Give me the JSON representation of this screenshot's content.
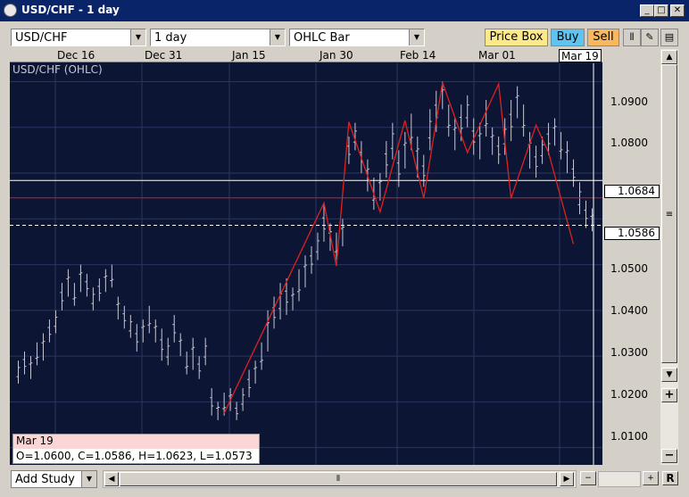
{
  "window": {
    "title": "USD/CHF - 1 day"
  },
  "toolbar": {
    "symbol": "USD/CHF",
    "period": "1 day",
    "chart_type": "OHLC Bar",
    "price_box_label": "Price Box",
    "buy_label": "Buy",
    "sell_label": "Sell"
  },
  "chart": {
    "label": "USD/CHF (OHLC)",
    "dates": [
      "Dec 16",
      "Dec 31",
      "Jan 15",
      "Jan 30",
      "Feb 14",
      "Mar 01",
      "Mar 19"
    ],
    "price_labels": [
      "1.0900",
      "1.0800",
      "1.0500",
      "1.0400",
      "1.0300",
      "1.0200",
      "1.0100"
    ],
    "line_price_white": "1.0684",
    "line_price_last": "1.0586",
    "colors": {
      "background": "#0d1535",
      "bars": "#c8c8d2",
      "zigzag": "#e02020",
      "hline_red": "#cc2222"
    }
  },
  "info": {
    "date": "Mar 19",
    "ohlc": "O=1.0600, C=1.0586, H=1.0623, L=1.0573"
  },
  "bottom": {
    "add_study": "Add Study",
    "r_label": "R"
  },
  "chart_data": {
    "type": "ohlc",
    "x_tick_labels": [
      "Dec 16",
      "Dec 31",
      "Jan 15",
      "Jan 30",
      "Feb 14",
      "Mar 01",
      "Mar 19"
    ],
    "y_tick_labels": [
      "1.0900",
      "1.0800",
      "1.0500",
      "1.0400",
      "1.0300",
      "1.0200",
      "1.0100"
    ],
    "ylim": [
      1.007,
      1.094
    ],
    "last_bar": {
      "date": "Mar 19",
      "open": 1.06,
      "high": 1.0623,
      "low": 1.0573,
      "close": 1.0586
    },
    "hlines": [
      {
        "value": 1.0684,
        "color": "white"
      },
      {
        "value": 1.0646,
        "color": "red"
      },
      {
        "value": 1.0586,
        "color": "white-dashed"
      }
    ],
    "bars_hl": [
      [
        1.024,
        1.029
      ],
      [
        1.026,
        1.031
      ],
      [
        1.025,
        1.03
      ],
      [
        1.028,
        1.033
      ],
      [
        1.029,
        1.035
      ],
      [
        1.033,
        1.038
      ],
      [
        1.035,
        1.04
      ],
      [
        1.04,
        1.046
      ],
      [
        1.043,
        1.049
      ],
      [
        1.041,
        1.046
      ],
      [
        1.044,
        1.05
      ],
      [
        1.043,
        1.048
      ],
      [
        1.04,
        1.045
      ],
      [
        1.042,
        1.047
      ],
      [
        1.044,
        1.049
      ],
      [
        1.045,
        1.05
      ],
      [
        1.038,
        1.043
      ],
      [
        1.036,
        1.041
      ],
      [
        1.034,
        1.039
      ],
      [
        1.031,
        1.037
      ],
      [
        1.033,
        1.038
      ],
      [
        1.035,
        1.041
      ],
      [
        1.033,
        1.038
      ],
      [
        1.029,
        1.036
      ],
      [
        1.028,
        1.034
      ],
      [
        1.033,
        1.039
      ],
      [
        1.03,
        1.035
      ],
      [
        1.026,
        1.031
      ],
      [
        1.027,
        1.034
      ],
      [
        1.025,
        1.03
      ],
      [
        1.028,
        1.034
      ],
      [
        1.017,
        1.023
      ],
      [
        1.016,
        1.02
      ],
      [
        1.017,
        1.022
      ],
      [
        1.018,
        1.023
      ],
      [
        1.016,
        1.02
      ],
      [
        1.018,
        1.023
      ],
      [
        1.021,
        1.027
      ],
      [
        1.024,
        1.029
      ],
      [
        1.027,
        1.033
      ],
      [
        1.031,
        1.04
      ],
      [
        1.036,
        1.043
      ],
      [
        1.038,
        1.046
      ],
      [
        1.039,
        1.047
      ],
      [
        1.04,
        1.045
      ],
      [
        1.042,
        1.049
      ],
      [
        1.045,
        1.052
      ],
      [
        1.048,
        1.054
      ],
      [
        1.051,
        1.057
      ],
      [
        1.055,
        1.063
      ],
      [
        1.053,
        1.059
      ],
      [
        1.051,
        1.057
      ],
      [
        1.054,
        1.06
      ],
      [
        1.072,
        1.078
      ],
      [
        1.075,
        1.081
      ],
      [
        1.07,
        1.077
      ],
      [
        1.066,
        1.073
      ],
      [
        1.062,
        1.069
      ],
      [
        1.064,
        1.07
      ],
      [
        1.069,
        1.077
      ],
      [
        1.073,
        1.081
      ],
      [
        1.067,
        1.075
      ],
      [
        1.071,
        1.079
      ],
      [
        1.075,
        1.083
      ],
      [
        1.069,
        1.078
      ],
      [
        1.067,
        1.074
      ],
      [
        1.075,
        1.084
      ],
      [
        1.079,
        1.088
      ],
      [
        1.084,
        1.09
      ],
      [
        1.078,
        1.085
      ],
      [
        1.075,
        1.082
      ],
      [
        1.077,
        1.085
      ],
      [
        1.08,
        1.087
      ],
      [
        1.074,
        1.082
      ],
      [
        1.073,
        1.081
      ],
      [
        1.078,
        1.086
      ],
      [
        1.074,
        1.08
      ],
      [
        1.072,
        1.078
      ],
      [
        1.074,
        1.082
      ],
      [
        1.077,
        1.086
      ],
      [
        1.082,
        1.089
      ],
      [
        1.078,
        1.085
      ],
      [
        1.071,
        1.079
      ],
      [
        1.069,
        1.076
      ],
      [
        1.072,
        1.078
      ],
      [
        1.074,
        1.081
      ],
      [
        1.076,
        1.082
      ],
      [
        1.073,
        1.079
      ],
      [
        1.07,
        1.077
      ],
      [
        1.067,
        1.073
      ],
      [
        1.061,
        1.068
      ],
      [
        1.058,
        1.064
      ],
      [
        1.0573,
        1.0623
      ]
    ],
    "zigzag": [
      [
        1.0175,
        33
      ],
      [
        1.0635,
        49
      ],
      [
        1.0497,
        51
      ],
      [
        1.0812,
        53
      ],
      [
        1.0615,
        58
      ],
      [
        1.0815,
        62
      ],
      [
        1.0645,
        65
      ],
      [
        1.0898,
        68
      ],
      [
        1.0745,
        72
      ],
      [
        1.0895,
        77
      ],
      [
        1.0645,
        79
      ],
      [
        1.0805,
        83
      ],
      [
        1.0745,
        85
      ],
      [
        1.0545,
        89
      ]
    ]
  }
}
